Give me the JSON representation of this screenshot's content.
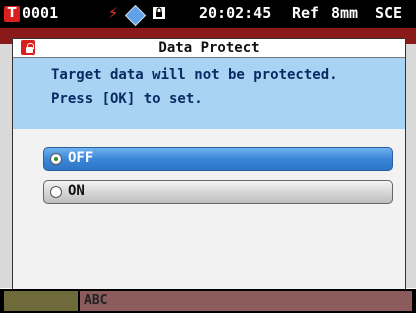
{
  "status": {
    "t_badge": "T",
    "target_id": "0001",
    "time": "20:02:45",
    "ref": "Ref",
    "aperture": "8mm",
    "mode": "SCE",
    "icons": [
      "battery-bolt-icon",
      "tag-icon",
      "lock-icon"
    ]
  },
  "dialog": {
    "title": "Data Protect",
    "message_line1": "Target data will not be protected.",
    "message_line2": "Press [OK] to set.",
    "icon": "protect-lock-icon",
    "options": [
      {
        "label": "OFF",
        "selected": true
      },
      {
        "label": "ON",
        "selected": false
      }
    ]
  },
  "bottom": {
    "field_label": "ABC"
  },
  "colors": {
    "accent_red": "#d8201e",
    "selection_blue": "#3b86d8",
    "header_blue": "#a9d3f3",
    "message_text": "#0a2a63"
  }
}
